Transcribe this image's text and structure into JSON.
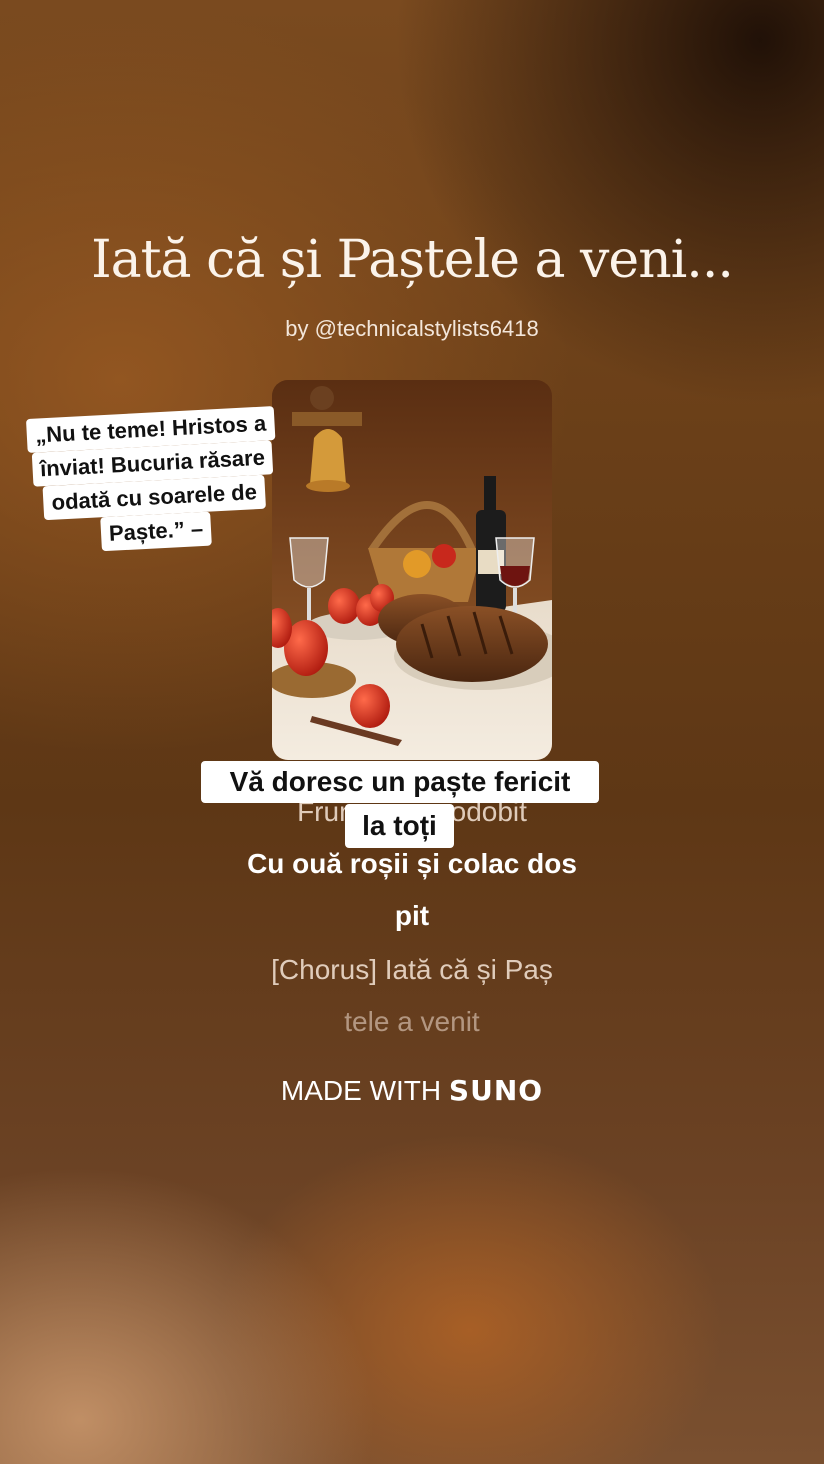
{
  "song": {
    "title": "Iată că și Paștele a veni...",
    "byline": "by @technicalstylists6418"
  },
  "lyrics": {
    "line_front_1": "Frun",
    "line_front_2": "odobit",
    "line_2": "Cu ouă roșii și colac dos",
    "line_3": "pit",
    "line_4": "[Chorus] Iată că și Paș",
    "line_5": "tele a venit"
  },
  "stickers": {
    "wish_line_1": "Vă doresc un paște fericit",
    "wish_line_2": "la toți",
    "quote_lines": [
      "„Nu te teme! Hristos a",
      "înviat! Bucuria răsare",
      "odată cu soarele de",
      "Paște.” –"
    ]
  },
  "footer": {
    "made_with": "MADE WITH",
    "brand": "SUNO"
  },
  "colors": {
    "bg_dark": "#2a160a",
    "bg_mid": "#6a3f18",
    "accent_red": "#c8281c",
    "sticker_bg": "#ffffff"
  }
}
